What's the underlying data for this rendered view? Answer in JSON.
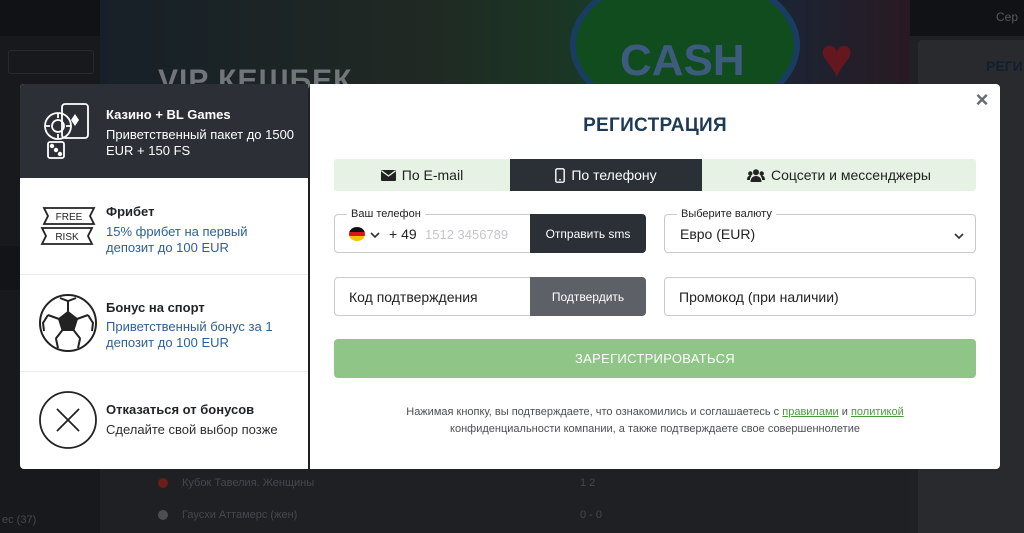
{
  "background": {
    "login_label": "Сер",
    "banner_text": "VIP КЕШБЕК",
    "banner_logo": "CASH",
    "right_panel_label": "РЕГИ",
    "left_count": "ес (37)",
    "rows": [
      {
        "text": "Кубок Тавелия. Женщины",
        "score": "1    2"
      },
      {
        "text": "Гаусхи Аттамерс (жен)",
        "score": "0 - 0"
      }
    ]
  },
  "bonus_panel": {
    "items": [
      {
        "title": "Казино + BL Games",
        "desc": "Приветственный пакет до 1500 EUR + 150 FS",
        "icon": "casino-chips-icon"
      },
      {
        "title": "Фрибет",
        "desc": "15% фрибет на первый депозит до 100 EUR",
        "icon": "free-risk-ticket-icon",
        "icon_text_top": "FREE",
        "icon_text_bottom": "RISK"
      },
      {
        "title": "Бонус на спорт",
        "desc": "Приветственный бонус за 1 депозит до 100 EUR",
        "icon": "soccer-ball-icon"
      },
      {
        "title": "Отказаться от бонусов",
        "desc": "Сделайте свой выбор позже",
        "icon": "decline-x-icon"
      }
    ]
  },
  "modal": {
    "title": "РЕГИСТРАЦИЯ",
    "close_label": "×",
    "tabs": [
      {
        "label": "По E-mail",
        "icon": "envelope-icon"
      },
      {
        "label": "По телефону",
        "icon": "phone-icon"
      },
      {
        "label": "Соцсети и мессенджеры",
        "icon": "users-icon"
      }
    ],
    "phone": {
      "label": "Ваш телефон",
      "dial_code": "+ 49",
      "placeholder": "1512 3456789",
      "send_button": "Отправить sms"
    },
    "currency": {
      "label": "Выберите валюту",
      "value": "Евро (EUR)"
    },
    "confirmation": {
      "placeholder": "Код подтверждения",
      "button": "Подтвердить"
    },
    "promo": {
      "placeholder": "Промокод (при наличии)"
    },
    "register_button": "ЗАРЕГИСТРИРОВАТЬСЯ",
    "legal": {
      "part1": "Нажимая кнопку, вы подтверждаете, что ознакомились и соглашаетесь с",
      "rules_link": "правилами",
      "and": "и",
      "policy_link": "политикой",
      "part2": "конфиденциальности компании, а также подтверждаете свое совершеннолетие"
    }
  },
  "colors": {
    "accent_green": "#8fc586",
    "dark": "#2b2f36",
    "title_blue": "#1e3a55",
    "link_green": "#4a9a3d"
  }
}
